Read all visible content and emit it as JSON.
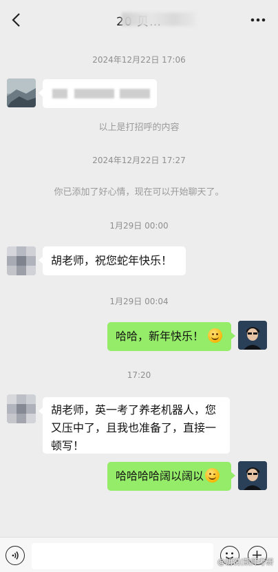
{
  "header": {
    "title": "20 贝…",
    "back_icon": "chevron-left-icon",
    "more_icon": "ellipsis-icon"
  },
  "messages": {
    "ts1": "2024年12月22日 17:06",
    "sys1": "以上是打招呼的内容",
    "ts2": "2024年12月22日 17:27",
    "sys2": "你已添加了好心情，现在可以开始聊天了。",
    "ts3": "1月29日 00:00",
    "msg1": "胡老师，祝您蛇年快乐！",
    "ts4": "1月29日 00:04",
    "msg2": "哈哈，新年快乐！",
    "ts5": "17:20",
    "msg3_line1": "胡老师，英一考了养老机器人，您",
    "msg3_line2": "又压中了，且我也准备了，直接一",
    "msg3_line3": "顿写！",
    "msg4": "哈哈哈哈阔以阔以"
  },
  "input_bar": {
    "voice_icon": "voice-icon",
    "emoji_icon": "emoji-icon",
    "plus_icon": "plus-icon",
    "input_value": ""
  },
  "watermark": "@胡说(凯师考研",
  "colors": {
    "background": "#ededed",
    "bubble_green": "#95ec69",
    "bubble_white": "#ffffff"
  }
}
